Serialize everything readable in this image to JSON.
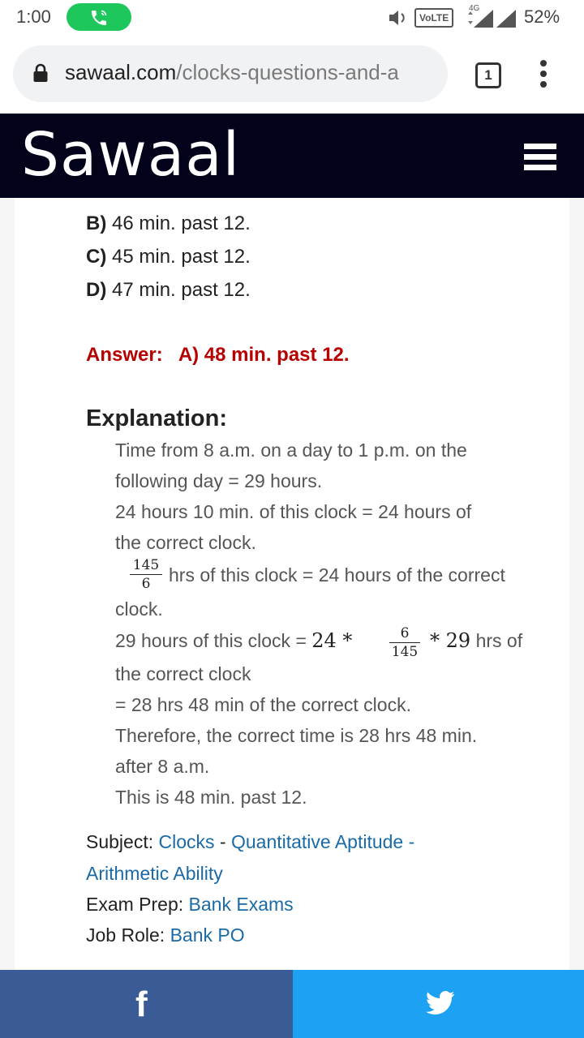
{
  "status_bar": {
    "time": "1:00",
    "network_badge": "VoLTE",
    "network_type": "4G",
    "battery": "52%"
  },
  "browser": {
    "url_domain": "sawaal.com",
    "url_path": "/clocks-questions-and-a",
    "tab_count": "1"
  },
  "site": {
    "logo": "Sawaal"
  },
  "question": {
    "options": [
      {
        "letter": "B)",
        "text": "46 min. past 12."
      },
      {
        "letter": "C)",
        "text": "45 min. past 12."
      },
      {
        "letter": "D)",
        "text": "47 min. past 12."
      }
    ],
    "answer_label": "Answer:",
    "answer_value": "A) 48 min. past 12."
  },
  "explanation": {
    "title": "Explanation:",
    "line1": "Time from 8 a.m. on a day to 1 p.m. on the",
    "line2": "following day = 29 hours.",
    "line3": "24 hours 10 min. of this clock = 24 hours of",
    "line4": "the correct clock.",
    "frac1_num": "145",
    "frac1_den": "6",
    "line5": "hrs of this clock = 24 hours of the correct",
    "line6": "clock.",
    "line7_pre": "29 hours of this clock =",
    "line7_math1": "24 *",
    "frac2_num": "6",
    "frac2_den": "145",
    "line7_math2": "* 29",
    "line7_post": "hrs of",
    "line8": "the correct clock",
    "line9": "= 28 hrs 48 min of the correct clock.",
    "line10": "Therefore, the correct time is 28 hrs 48 min.",
    "line11": "after 8 a.m.",
    "line12": "This is 48 min. past 12."
  },
  "meta": {
    "subject_label": "Subject:",
    "subject_link1": "Clocks",
    "subject_sep1": " - ",
    "subject_link2": "Quantitative Aptitude -",
    "subject_link3": "Arithmetic Ability",
    "exam_label": "Exam Prep:",
    "exam_link": "Bank Exams",
    "job_label": "Job Role:",
    "job_link": "Bank PO"
  },
  "share": {
    "facebook_icon": "facebook-icon",
    "twitter_icon": "twitter-icon"
  },
  "colors": {
    "header_bg": "#03021b",
    "answer": "#b80000",
    "link": "#1a6aa6",
    "facebook": "#3b5b96",
    "twitter": "#1da1f2",
    "call_pill": "#1ec75b"
  }
}
